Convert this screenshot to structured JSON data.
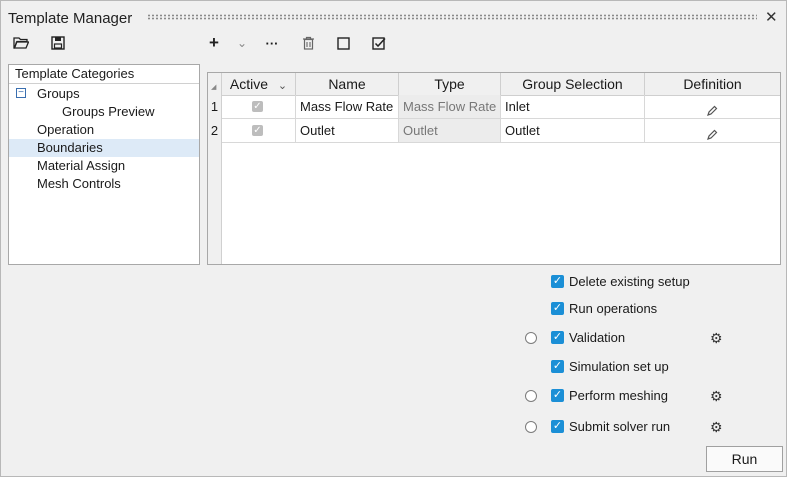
{
  "window": {
    "title": "Template Manager",
    "close": "✕"
  },
  "toolbar": {
    "open": "open-folder",
    "save": "save",
    "add": "+",
    "add_dropdown": "⌄",
    "more": "···",
    "delete": "trash",
    "deselect_all": "square",
    "select_all": "checked-square"
  },
  "categories": {
    "header": "Template Categories",
    "expander": "−",
    "items": [
      "Groups",
      "Groups Preview",
      "Operation",
      "Boundaries",
      "Material Assign",
      "Mesh Controls"
    ],
    "selected": "Boundaries"
  },
  "grid": {
    "corner": "◢",
    "columns": [
      "Active",
      "Name",
      "Type",
      "Group Selection",
      "Definition"
    ],
    "active_sort": "⌄",
    "rows": [
      {
        "num": "1",
        "active": "✓",
        "name": "Mass Flow Rate",
        "type": "Mass Flow Rate",
        "group": "Inlet",
        "definition": "pencil"
      },
      {
        "num": "2",
        "active": "✓",
        "name": "Outlet",
        "type": "Outlet",
        "group": "Outlet",
        "definition": "pencil"
      }
    ]
  },
  "options": [
    {
      "label": "Delete existing setup",
      "checked": true,
      "radio": false,
      "gear": false
    },
    {
      "label": "Run operations",
      "checked": true,
      "radio": false,
      "gear": false
    },
    {
      "label": "Validation",
      "checked": true,
      "radio": true,
      "gear": true
    },
    {
      "label": "Simulation set up",
      "checked": true,
      "radio": false,
      "gear": false
    },
    {
      "label": "Perform meshing",
      "checked": true,
      "radio": true,
      "gear": true
    },
    {
      "label": "Submit solver run",
      "checked": true,
      "radio": true,
      "gear": true
    }
  ],
  "check_glyph": "✓",
  "gear_glyph": "⚙",
  "run_label": "Run"
}
